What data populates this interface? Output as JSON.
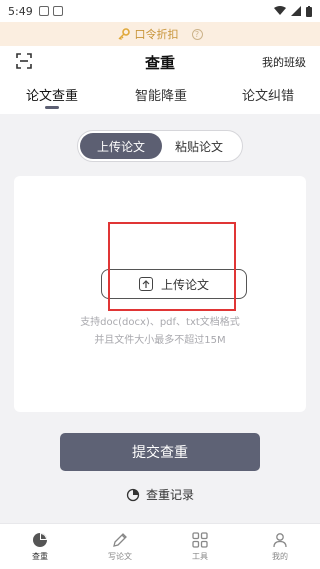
{
  "status_bar": {
    "time": "5:49"
  },
  "promo": {
    "text": "口令折扣",
    "help_symbol": "?",
    "accent": "#c8953a"
  },
  "header": {
    "title": "查重",
    "right_link": "我的班级"
  },
  "tabs": [
    {
      "label": "论文查重",
      "active": true
    },
    {
      "label": "智能降重",
      "active": false
    },
    {
      "label": "论文纠错",
      "active": false
    }
  ],
  "segment": {
    "active_label": "上传论文",
    "inactive_label": "粘贴论文"
  },
  "upload": {
    "button_label": "上传论文",
    "hint_line1": "支持doc(docx)、pdf、txt文档格式",
    "hint_line2": "并且文件大小最多不超过15M"
  },
  "submit": {
    "label": "提交查重"
  },
  "record": {
    "label": "查重记录"
  },
  "bottom_nav": [
    {
      "label": "查重",
      "icon": "pie-chart-icon",
      "active": true
    },
    {
      "label": "写论文",
      "icon": "pen-icon",
      "active": false
    },
    {
      "label": "工具",
      "icon": "grid-icon",
      "active": false
    },
    {
      "label": "我的",
      "icon": "person-icon",
      "active": false
    }
  ],
  "colors": {
    "primary": "#5e6275",
    "highlight": "#e03535",
    "promo_bg": "#fbeee0"
  }
}
